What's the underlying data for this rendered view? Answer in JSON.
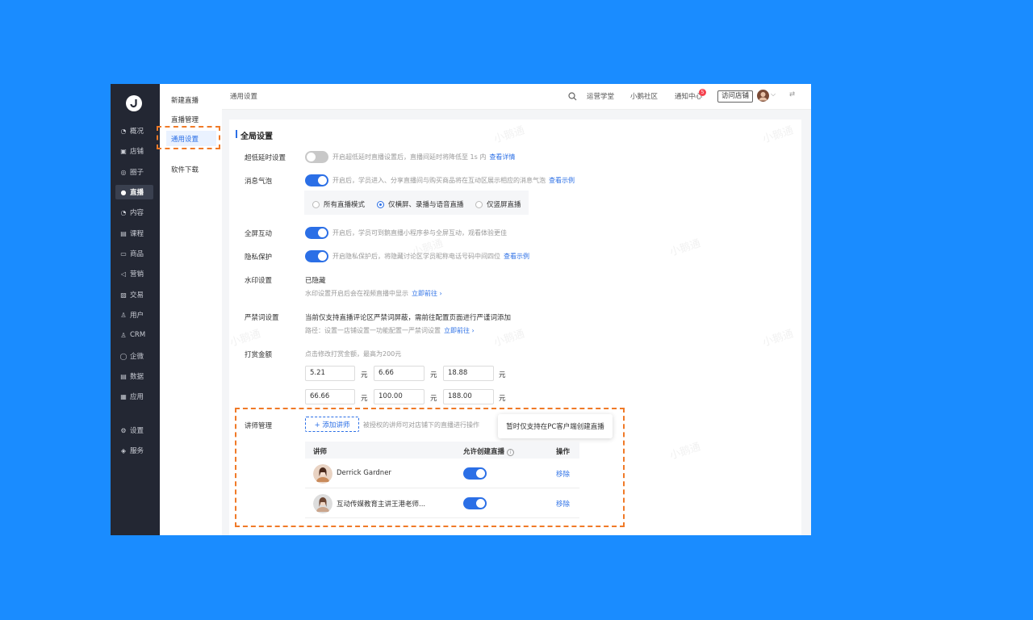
{
  "nav": {
    "items": [
      {
        "label": "概况",
        "icon": "pie-icon",
        "glyph": "◔"
      },
      {
        "label": "店铺",
        "icon": "store-icon",
        "glyph": "▣"
      },
      {
        "label": "圈子",
        "icon": "group-icon",
        "glyph": "◎"
      },
      {
        "label": "直播",
        "icon": "live-icon",
        "glyph": "●"
      },
      {
        "label": "内容",
        "icon": "content-icon",
        "glyph": "◔"
      },
      {
        "label": "课程",
        "icon": "course-icon",
        "glyph": "▤"
      },
      {
        "label": "商品",
        "icon": "goods-icon",
        "glyph": "▭"
      },
      {
        "label": "营销",
        "icon": "marketing-icon",
        "glyph": "◁"
      },
      {
        "label": "交易",
        "icon": "trade-icon",
        "glyph": "▨"
      },
      {
        "label": "用户",
        "icon": "user-icon",
        "glyph": "♙"
      },
      {
        "label": "CRM",
        "icon": "crm-icon",
        "glyph": "♙"
      },
      {
        "label": "企微",
        "icon": "wecom-icon",
        "glyph": "◯"
      },
      {
        "label": "数据",
        "icon": "data-icon",
        "glyph": "▤"
      },
      {
        "label": "应用",
        "icon": "apps-icon",
        "glyph": "▦"
      },
      {
        "label": "设置",
        "icon": "settings-icon",
        "glyph": "⚙"
      },
      {
        "label": "服务",
        "icon": "service-icon",
        "glyph": "◈"
      }
    ],
    "active": "直播"
  },
  "submenu": {
    "items": [
      "新建直播",
      "直播管理",
      "通用设置",
      "软件下载"
    ],
    "active": "通用设置"
  },
  "topbar": {
    "breadcrumb": "通用设置",
    "links": [
      "运营学堂",
      "小鹅社区",
      "通知中心"
    ],
    "notify_count": "5",
    "visit_store": "访问店铺"
  },
  "section": {
    "title": "全局设置",
    "low_latency": {
      "label": "超低延时设置",
      "on": false,
      "desc": "开启超低延时直播设置后，直播间延时将降低至 1s 内",
      "link": "查看详情"
    },
    "bubble": {
      "label": "消息气泡",
      "on": true,
      "desc": "开启后，学员进入、分享直播间与购买商品将在互动区展示相应的消息气泡",
      "link": "查看示例",
      "options": [
        "所有直播模式",
        "仅横屏、录播与语音直播",
        "仅竖屏直播"
      ],
      "selected": 1
    },
    "fullscreen": {
      "label": "全屏互动",
      "on": true,
      "desc": "开启后，学员可到鹅直播小程序参与全屏互动，观看体验更佳"
    },
    "privacy": {
      "label": "隐私保护",
      "on": true,
      "desc": "开启隐私保护后，将隐藏讨论区学员昵称电话号码中间四位",
      "link": "查看示例"
    },
    "watermark": {
      "label": "水印设置",
      "status": "已隐藏",
      "desc": "水印设置开启后会在视频直播中显示",
      "link": "立即前往 ›"
    },
    "banned": {
      "label": "严禁词设置",
      "status": "当前仅支持直播评论区严禁词屏蔽，需前往配置页面进行严谨词添加",
      "desc": "路径：设置一店铺设置一功能配置一严禁词设置",
      "link": "立即前往 ›"
    },
    "reward": {
      "label": "打赏金额",
      "desc": "点击修改打赏金额，最高为200元",
      "amounts": [
        "5.21",
        "6.66",
        "18.88",
        "66.66",
        "100.00",
        "188.00"
      ],
      "unit": "元"
    },
    "lecturer": {
      "label": "讲师管理",
      "add_button": "+ 添加讲师",
      "desc": "被授权的讲师可对店铺下的直播进行操作",
      "tooltip": "暂时仅支持在PC客户端创建直播",
      "columns": [
        "讲师",
        "允许创建直播",
        "操作"
      ],
      "rows": [
        {
          "name": "Derrick Gardner",
          "allow": true,
          "action": "移除"
        },
        {
          "name": "互动传媒教育主讲王港老师...",
          "allow": true,
          "action": "移除"
        }
      ]
    }
  },
  "watermark_text": "小鹅通",
  "colors": {
    "brand": "#2b6fe6",
    "highlight": "#f07a28",
    "background": "#1a8cff"
  }
}
